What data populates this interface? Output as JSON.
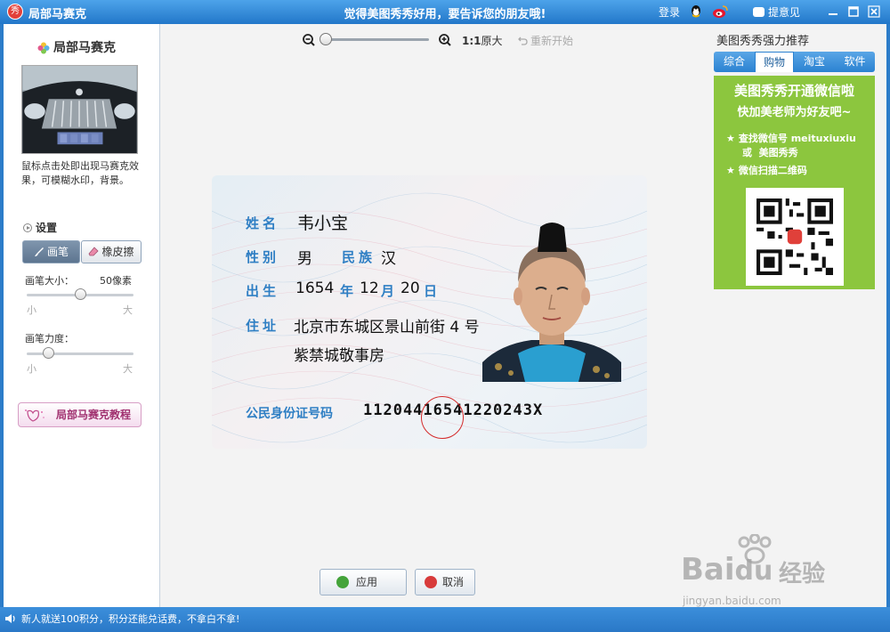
{
  "titlebar": {
    "app_logo": "秀",
    "app_title": "局部马赛克",
    "center_message": "觉得美图秀秀好用，要告诉您的朋友哦!",
    "login": "登录",
    "feedback": "提意见",
    "icons": [
      "qq-icon",
      "weibo-icon",
      "minimize-icon",
      "maximize-icon",
      "close-icon"
    ]
  },
  "left_panel": {
    "title": "局部马赛克",
    "description": "鼠标点击处即出现马赛克效果，可模糊水印，背景。",
    "settings_heading": "设置",
    "brush_tab": "画笔",
    "eraser_tab": "橡皮擦",
    "brush_size_label": "画笔大小：",
    "brush_size_value": "50像素",
    "brush_size_level": 0.5,
    "brush_strength_label": "画笔力度：",
    "brush_strength_level": 0.2,
    "range_small": "小",
    "range_large": "大",
    "tutorial_button": "局部马赛克教程"
  },
  "toolbar": {
    "zoom_level": 0.0,
    "original_size_prefix": "1:1",
    "original_size": "原大",
    "restart": "重新开始"
  },
  "id_card": {
    "name_label": "姓名",
    "name_value": "韦小宝",
    "gender_label": "性别",
    "gender_value": "男",
    "ethnicity_label": "民族",
    "ethnicity_value": "汉",
    "birth_label": "出生",
    "birth_year": "1654",
    "birth_year_unit": "年",
    "birth_month": "12",
    "birth_month_unit": "月",
    "birth_day": "20",
    "birth_day_unit": "日",
    "address_label": "住址",
    "address_line1": "北京市东城区景山前街 4 号",
    "address_line2": "紫禁城敬事房",
    "id_number_label": "公民身份证号码",
    "id_number_value": "11204416541220243X"
  },
  "actions": {
    "apply": "应用",
    "cancel": "取消"
  },
  "right_panel": {
    "title": "美图秀秀强力推荐",
    "tabs": [
      "综合",
      "购物",
      "淘宝",
      "软件"
    ],
    "active_tab": 1,
    "promo_headline": "美图秀秀开通微信啦",
    "promo_subline": "快加美老师为好友吧~",
    "promo_item1_prefix": "查找微信号",
    "promo_item1_id": "meituxiuxiu",
    "promo_item1_or": "或",
    "promo_item1_name": "美图秀秀",
    "promo_item2": "微信扫描二维码"
  },
  "statusbar": {
    "message": "新人就送100积分，积分还能兑话费，不拿白不拿!"
  },
  "watermark": {
    "brand": "Bai",
    "brand_suffix": "du",
    "cn": "经验",
    "url": "jingyan.baidu.com"
  },
  "colors": {
    "titlebar": "#2a7fd0",
    "card_label": "#2f7fc4",
    "promo_green": "#8cc63e",
    "accent_red": "#d42a2a"
  }
}
